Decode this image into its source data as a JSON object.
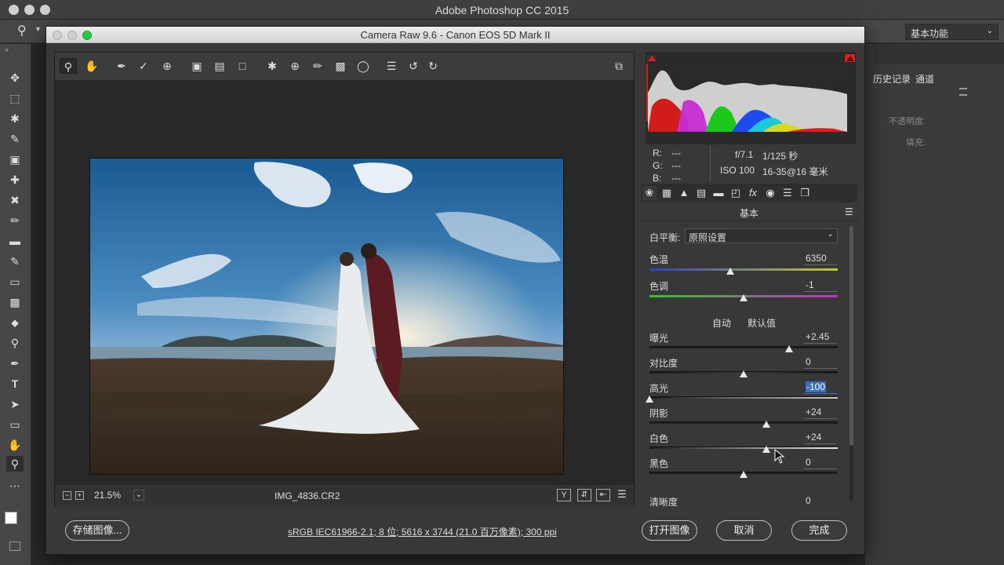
{
  "app": {
    "title": "Adobe Photoshop CC 2015"
  },
  "options_bar": {
    "workspace": "基本功能"
  },
  "panels": {
    "history": "历史记录",
    "channels": "通道",
    "opacity": "不透明度:",
    "fill": "填充:"
  },
  "dialog": {
    "title": "Camera Raw 9.6 -  Canon EOS 5D Mark II",
    "zoom": "21.5%",
    "filename": "IMG_4836.CR2",
    "workflow": "sRGB IEC61966-2.1;  8 位;   5616 x 3744 (21.0 百万像素);  300 ppi",
    "buttons": {
      "save": "存储图像...",
      "open": "打开图像",
      "cancel": "取消",
      "done": "完成"
    }
  },
  "info": {
    "r_label": "R:",
    "g_label": "G:",
    "b_label": "B:",
    "r": "---",
    "g": "---",
    "b": "---",
    "aperture": "f/7.1",
    "shutter": "1/125 秒",
    "iso": "ISO 100",
    "lens": "16-35@16 毫米"
  },
  "basic": {
    "section_title": "基本",
    "wb_label": "白平衡:",
    "wb_value": "原照设置",
    "auto": "自动",
    "default": "默认值",
    "temp": {
      "label": "色温",
      "value": "6350",
      "level": 0.43
    },
    "tint": {
      "label": "色调",
      "value": "-1",
      "level": 0.5
    },
    "exposure": {
      "label": "曝光",
      "value": "+2.45",
      "level": 0.74
    },
    "contrast": {
      "label": "对比度",
      "value": "0",
      "level": 0.5
    },
    "highlights": {
      "label": "高光",
      "value": "-100",
      "level": 0.0
    },
    "shadows": {
      "label": "阴影",
      "value": "+24",
      "level": 0.62
    },
    "whites": {
      "label": "白色",
      "value": "+24",
      "level": 0.62
    },
    "blacks": {
      "label": "黑色",
      "value": "0",
      "level": 0.5
    },
    "clarity": {
      "label": "清晰度",
      "value": "0"
    }
  },
  "colors": {
    "accent_highlight": "#3d6fbf",
    "ps_bg": "#282828",
    "panel": "#383838"
  }
}
